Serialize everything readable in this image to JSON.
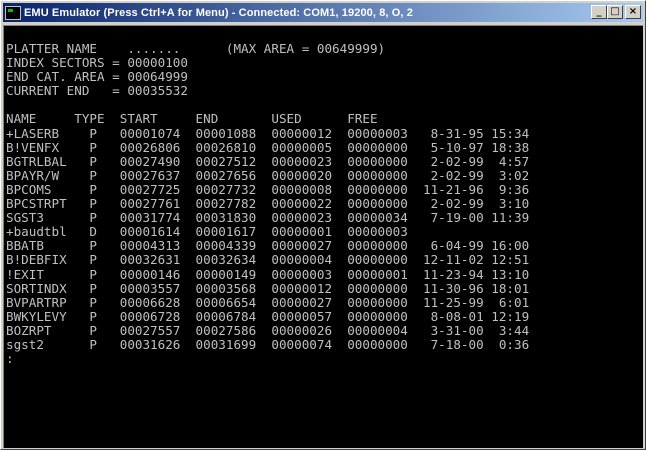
{
  "window": {
    "title": "EMU Emulator (Press Ctrl+A for Menu) - Connected: COM1, 19200, 8, O, 2",
    "buttons": {
      "minimize": "_",
      "maximize": "□",
      "close": "×"
    }
  },
  "terminal": {
    "lines": [
      "PLATTER NAME    .......      (MAX AREA = 00649999)",
      "INDEX SECTORS = 00000100",
      "END CAT. AREA = 00064999",
      "CURRENT END   = 00035532",
      "",
      "NAME     TYPE  START     END       USED      FREE",
      "+LASERB    P   00001074  00001088  00000012  00000003   8-31-95 15:34",
      "B!VENFX    P   00026806  00026810  00000005  00000000   5-10-97 18:38",
      "BGTRLBAL   P   00027490  00027512  00000023  00000000   2-02-99  4:57",
      "BPAYR/W    P   00027637  00027656  00000020  00000000   2-02-99  3:02",
      "BPCOMS     P   00027725  00027732  00000008  00000000  11-21-96  9:36",
      "BPCSTRPT   P   00027761  00027782  00000022  00000000   2-02-99  3:10",
      "SGST3      P   00031774  00031830  00000023  00000034   7-19-00 11:39",
      "+baudtbl   D   00001614  00001617  00000001  00000003",
      "BBATB      P   00004313  00004339  00000027  00000000   6-04-99 16:00",
      "B!DEBFIX   P   00032631  00032634  00000004  00000000  12-11-02 12:51",
      "!EXIT      P   00000146  00000149  00000003  00000001  11-23-94 13:10",
      "SORTINDX   P   00003557  00003568  00000012  00000000  11-30-96 18:01",
      "BVPARTRP   P   00006628  00006654  00000027  00000000  11-25-99  6:01",
      "BWKYLEVY   P   00006728  00006784  00000057  00000000   8-08-01 12:19",
      "BOZRPT     P   00027557  00027586  00000026  00000004   3-31-00  3:44",
      "sgst2      P   00031626  00031699  00000074  00000000   7-18-00  0:36",
      ":"
    ]
  }
}
